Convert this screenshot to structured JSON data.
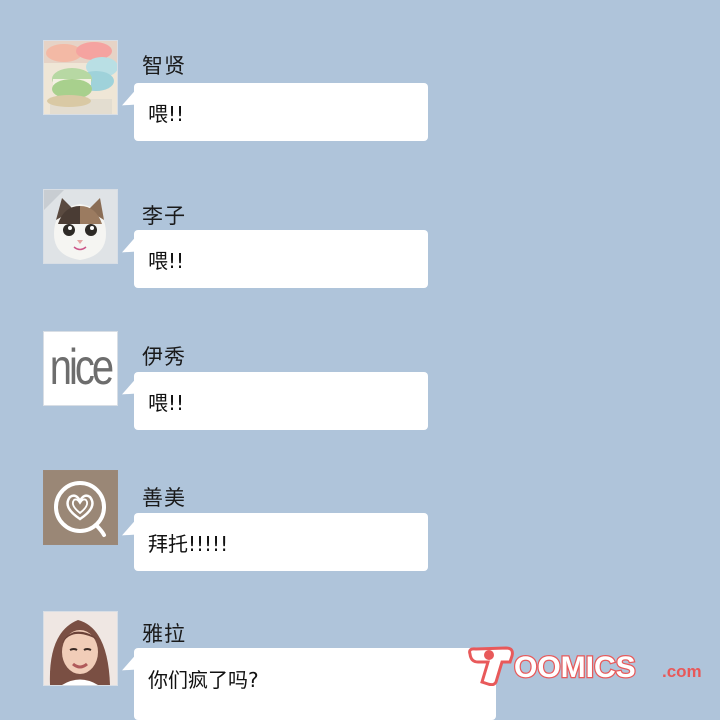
{
  "messages": [
    {
      "sender": "智贤",
      "text": "喂!!",
      "avatar": "macaron-avatar"
    },
    {
      "sender": "李子",
      "text": "喂!!",
      "avatar": "cat-avatar"
    },
    {
      "sender": "伊秀",
      "text": "喂!!",
      "avatar": "nice-text-avatar"
    },
    {
      "sender": "善美",
      "text": "拜托!!!!!",
      "avatar": "latte-art-avatar"
    },
    {
      "sender": "雅拉",
      "text": "你们疯了吗?",
      "avatar": "woman-portrait-avatar"
    }
  ],
  "avatar_text": {
    "nice": "nice"
  },
  "watermark": {
    "text": "TOOMICS.com",
    "color": "#e8595a"
  },
  "colors": {
    "background": "#afc4da",
    "bubble": "#ffffff"
  }
}
